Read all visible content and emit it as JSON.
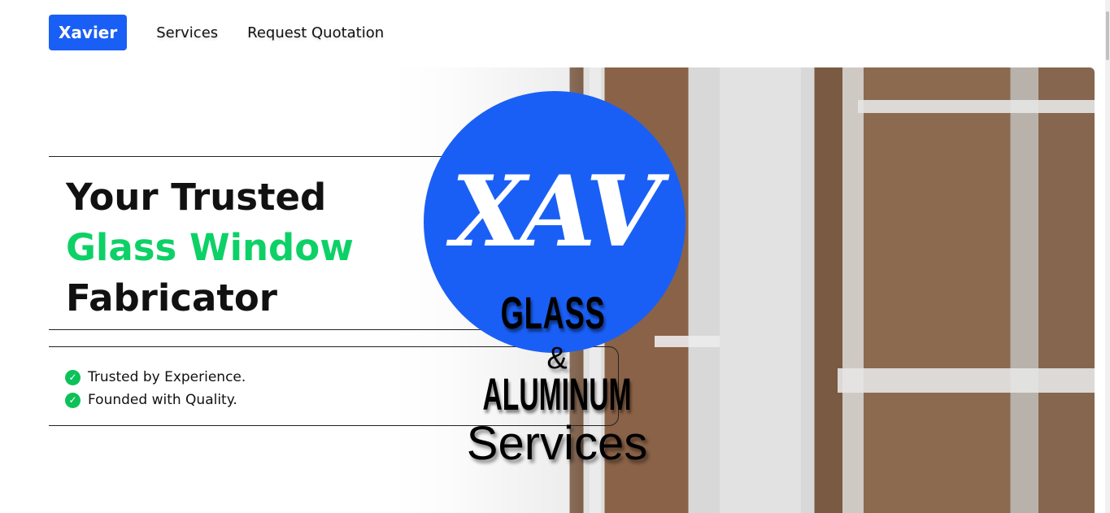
{
  "nav": {
    "brand": "Xavier",
    "links": [
      "Services",
      "Request Quotation"
    ]
  },
  "hero": {
    "heading_line1": "Your Trusted",
    "heading_highlight": "Glass Window",
    "heading_line3": "Fabricator",
    "features": [
      "Trusted by Experience.",
      "Founded with Quality."
    ],
    "logo": {
      "monogram": "XAV",
      "line1": "GLASS",
      "line2": "&",
      "line3": "ALUMINUM",
      "line4": "Services"
    }
  },
  "colors": {
    "brand": "#1a5ff5",
    "highlight": "#0dd166",
    "check": "#0dc159"
  },
  "icons": {
    "feature": "check-circle-icon"
  }
}
